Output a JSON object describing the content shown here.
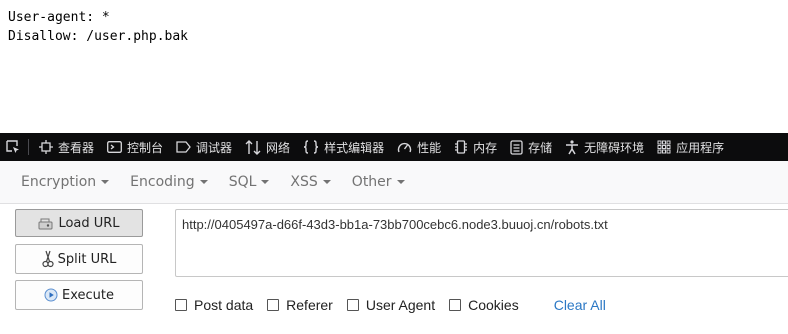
{
  "robots": {
    "line1": "User-agent: *",
    "line2": "Disallow: /user.php.bak"
  },
  "devtools": {
    "tabs": [
      {
        "label": "查看器",
        "icon": "inspector-icon"
      },
      {
        "label": "控制台",
        "icon": "console-icon"
      },
      {
        "label": "调试器",
        "icon": "debugger-icon"
      },
      {
        "label": "网络",
        "icon": "network-icon"
      },
      {
        "label": "样式编辑器",
        "icon": "style-editor-icon"
      },
      {
        "label": "性能",
        "icon": "performance-icon"
      },
      {
        "label": "内存",
        "icon": "memory-icon"
      },
      {
        "label": "存储",
        "icon": "storage-icon"
      },
      {
        "label": "无障碍环境",
        "icon": "accessibility-icon"
      },
      {
        "label": "应用程序",
        "icon": "application-icon"
      }
    ]
  },
  "hackbar": {
    "menu": [
      "Encryption",
      "Encoding",
      "SQL",
      "XSS",
      "Other"
    ],
    "buttons": {
      "load_url": "Load URL",
      "split_url": "Split URL",
      "execute": "Execute"
    },
    "url_value": "http://0405497a-d66f-43d3-bb1a-73bb700cebc6.node3.buuoj.cn/robots.txt",
    "options": {
      "post_data": "Post data",
      "referer": "Referer",
      "user_agent": "User Agent",
      "cookies": "Cookies",
      "clear_all": "Clear All"
    }
  }
}
